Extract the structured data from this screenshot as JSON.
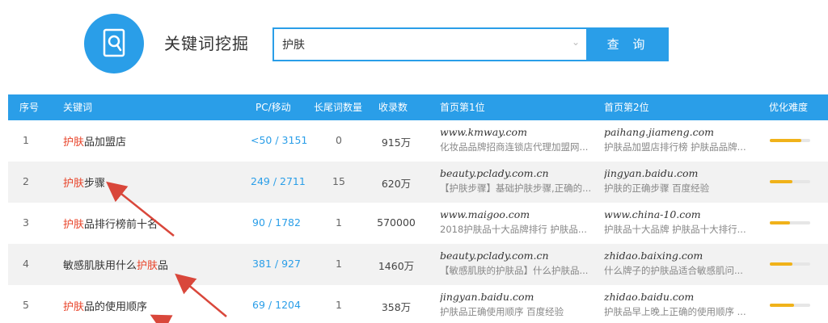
{
  "header": {
    "title": "关键词挖掘",
    "search_value": "护肤",
    "search_button": "查 询"
  },
  "table": {
    "columns": [
      "序号",
      "关键词",
      "PC/移动",
      "长尾词数量",
      "收录数",
      "首页第1位",
      "首页第2位",
      "优化难度"
    ],
    "rows": [
      {
        "idx": "1",
        "kw_pre": "",
        "kw_hl": "护肤",
        "kw_post": "品加盟店",
        "pc": "<50 / 3151",
        "long": "0",
        "indexed": "915万",
        "r1_site": "www.kmway.com",
        "r1_desc": "化妆品品牌招商连锁店代理加盟网...",
        "r2_site": "paihang.jiameng.com",
        "r2_desc": "护肤品加盟店排行榜 护肤品品牌...",
        "difficulty": 0.78
      },
      {
        "idx": "2",
        "kw_pre": "",
        "kw_hl": "护肤",
        "kw_post": "步骤",
        "pc": "249 / 2711",
        "long": "15",
        "indexed": "620万",
        "r1_site": "beauty.pclady.com.cn",
        "r1_desc": "【护肤步骤】基础护肤步骤,正确的...",
        "r2_site": "jingyan.baidu.com",
        "r2_desc": "护肤的正确步骤 百度经验",
        "difficulty": 0.55
      },
      {
        "idx": "3",
        "kw_pre": "",
        "kw_hl": "护肤",
        "kw_post": "品排行榜前十名",
        "pc": "90 / 1782",
        "long": "1",
        "indexed": "570000",
        "r1_site": "www.maigoo.com",
        "r1_desc": "2018护肤品十大品牌排行 护肤品...",
        "r2_site": "www.china-10.com",
        "r2_desc": "护肤品十大品牌 护肤品十大排行...",
        "difficulty": 0.5
      },
      {
        "idx": "4",
        "kw_pre": "敏感肌肤用什么",
        "kw_hl": "护肤",
        "kw_post": "品",
        "pc": "381 / 927",
        "long": "1",
        "indexed": "1460万",
        "r1_site": "beauty.pclady.com.cn",
        "r1_desc": "【敏感肌肤的护肤品】什么护肤品...",
        "r2_site": "zhidao.baixing.com",
        "r2_desc": "什么牌子的护肤品适合敏感肌问...",
        "difficulty": 0.55
      },
      {
        "idx": "5",
        "kw_pre": "",
        "kw_hl": "护肤",
        "kw_post": "品的使用顺序",
        "pc": "69 / 1204",
        "long": "1",
        "indexed": "358万",
        "r1_site": "jingyan.baidu.com",
        "r1_desc": "护肤品正确使用顺序 百度经验",
        "r2_site": "zhidao.baidu.com",
        "r2_desc": "护肤品早上晚上正确的使用顺序 ...",
        "difficulty": 0.6
      }
    ]
  },
  "colors": {
    "accent": "#2a9ee8",
    "highlight": "#e8442a",
    "difficulty": "#f0b21a",
    "arrow": "#d9473b"
  }
}
